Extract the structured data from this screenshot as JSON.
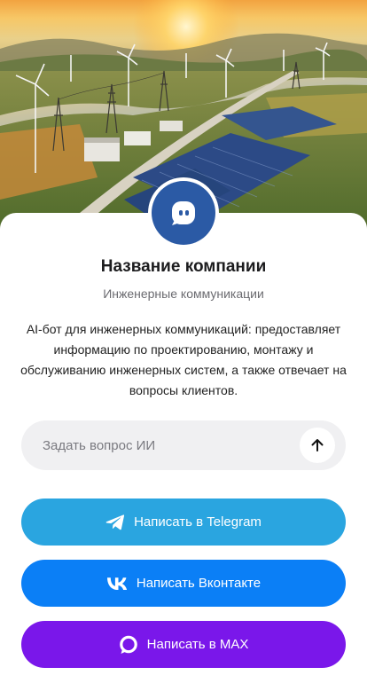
{
  "company": {
    "name": "Название компании",
    "subtitle": "Инженерные коммуникации",
    "description": "AI-бот для инженерных коммуникаций: предоставляет информацию по проектированию, монтажу и обслуживанию инженерных систем, а также отвечает на вопросы клиентов."
  },
  "ask": {
    "placeholder": "Задать вопрос ИИ",
    "value": ""
  },
  "buttons": {
    "telegram": "Написать в Telegram",
    "vkontakte": "Написать Вконтакте",
    "max": "Написать в MAX"
  },
  "icons": {
    "avatar": "chat-bubble-icon",
    "send": "arrow-up-icon",
    "telegram": "telegram-icon",
    "vk": "vk-icon",
    "max": "max-icon"
  },
  "colors": {
    "avatar": "#2b5aa5",
    "telegram": "#2aa5e0",
    "vkontakte": "#0b7ff6",
    "max": "#7a17ea",
    "input_bg": "#f0f0f2"
  }
}
